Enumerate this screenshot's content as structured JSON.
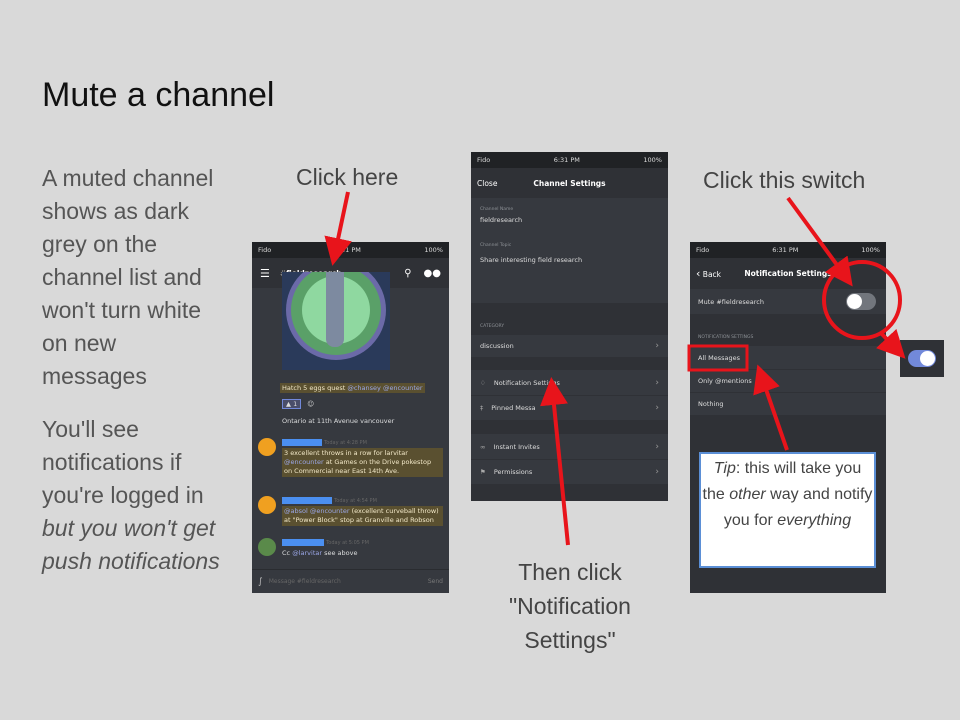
{
  "title": "Mute a channel",
  "description1": "A muted channel shows as dark grey on the channel list and won't turn white on new messages",
  "description2_plain": "You'll see notifications if you're logged in",
  "description2_em": "but you won't get push notifications",
  "callouts": {
    "click_here": "Click here",
    "then_click": "Then click \"Notification Settings\"",
    "click_switch": "Click this switch"
  },
  "tip": {
    "label": "Tip",
    "text1": ": this will take you the ",
    "em1": "other",
    "text2": " way and notify you for ",
    "em2": "everything"
  },
  "phone1": {
    "status": {
      "carrier": "Fido",
      "time": "6:31 PM",
      "battery": "100%"
    },
    "channel": "fieldresearch",
    "messages": [
      {
        "text": "Hatch 5 eggs quest",
        "mentions": "@chansey @encounter"
      },
      {
        "reaction_count": "1",
        "text": "Ontario at 11th Avenue vancouver"
      },
      {
        "time": "Today at 4:28 PM",
        "text": "3 excellent throws in a row for larvitar",
        "mention": "@encounter",
        "text2": "at Games on the Drive pokestop on Commercial near East 14th Ave."
      },
      {
        "time": "Today at 4:54 PM",
        "mention1": "@absol",
        "mention2": "@encounter",
        "text": "(excellent curveball throw) at \"Power Block\" stop at Granville and Robson"
      },
      {
        "time": "Today at 5:05 PM",
        "prefix": "Cc",
        "mention": "@larvitar",
        "text": "see above"
      }
    ],
    "input_placeholder": "Message #fieldresearch",
    "send": "Send"
  },
  "phone2": {
    "status": {
      "carrier": "Fido",
      "time": "6:31 PM",
      "battery": "100%"
    },
    "close": "Close",
    "title": "Channel Settings",
    "channel_name_label": "Channel Name",
    "channel_name": "fieldresearch",
    "channel_topic_label": "Channel Topic",
    "channel_topic": "Share interesting field research",
    "category_label": "CATEGORY",
    "category": "discussion",
    "notification_settings": "Notification Settings",
    "pinned_messages": "Pinned Messa",
    "instant_invites": "Instant Invites",
    "permissions": "Permissions"
  },
  "phone3": {
    "status": {
      "carrier": "Fido",
      "time": "6:31 PM",
      "battery": "100%"
    },
    "back": "Back",
    "title": "Notification Settings",
    "mute_label": "Mute #fieldresearch",
    "mute_on": false,
    "section_label": "NOTIFICATION SETTINGS",
    "options": [
      "All Messages",
      "Only @mentions",
      "Nothing"
    ]
  },
  "colors": {
    "arrow": "#e8141b",
    "toggle_on": "#7289da",
    "highlight_border": "#5b8fd6"
  }
}
